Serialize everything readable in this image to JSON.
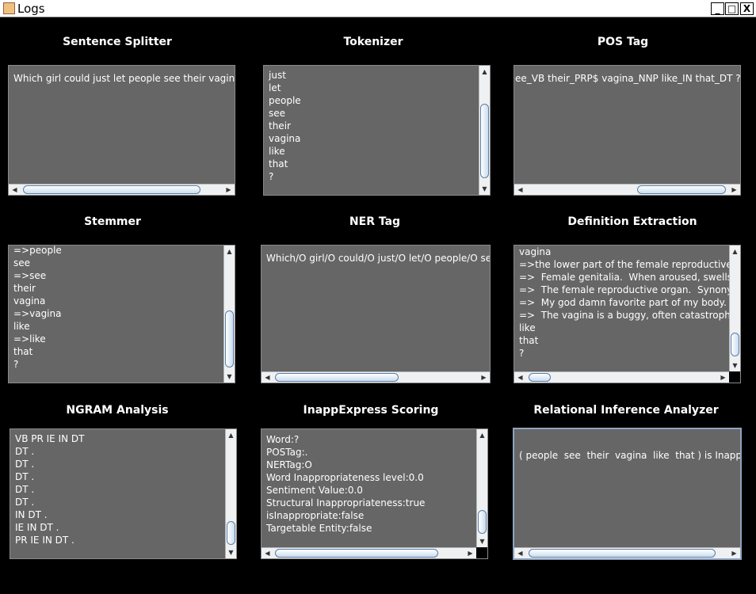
{
  "window": {
    "title": "Logs",
    "minimize": "_",
    "maximize": "□",
    "close": "X"
  },
  "panels": {
    "sentence_splitter": {
      "title": "Sentence Splitter",
      "lines": [
        "Which girl could just let people see their vagina like"
      ]
    },
    "tokenizer": {
      "title": "Tokenizer",
      "lines": [
        "just",
        "let",
        "people",
        "see",
        "their",
        "vagina",
        "like",
        "that",
        "?"
      ]
    },
    "pos_tag": {
      "title": "POS Tag",
      "lines": [
        "ee_VB their_PRP$ vagina_NNP like_IN that_DT ?_."
      ]
    },
    "stemmer": {
      "title": "Stemmer",
      "lines": [
        "=>people",
        "see",
        "=>see",
        "their",
        "vagina",
        "=>vagina",
        "like",
        "=>like",
        "that",
        "?"
      ]
    },
    "ner_tag": {
      "title": "NER Tag",
      "lines": [
        "Which/O girl/O could/O just/O let/O people/O see/O t"
      ]
    },
    "definition_extraction": {
      "title": "Definition Extraction",
      "lines": [
        "vagina",
        "=>the lower part of the female reproductive tract;",
        "=>  Female genitalia.  When aroused, swells and",
        "=>  The female reproductive organ.  Synonyms ir",
        "=>  My god damn favorite part of my body. Whene",
        "=>  The vagina is a buggy, often catastrophically",
        "like",
        "that",
        "?"
      ]
    },
    "ngram_analysis": {
      "title": "NGRAM Analysis",
      "lines": [
        "VB PR IE IN DT",
        "DT .",
        "DT .",
        "DT .",
        "DT .",
        "DT .",
        "IN DT .",
        "IE IN DT .",
        "PR IE IN DT ."
      ]
    },
    "inappexpress_scoring": {
      "title": "InappExpress Scoring",
      "lines": [
        "Word:?",
        "POSTag:.",
        "NERTag:O",
        "Word Inappropriateness level:0.0",
        "Sentiment Value:0.0",
        "Structural Inappropriateness:true",
        "isInappropriate:false",
        "Targetable Entity:false"
      ]
    },
    "relational_inference": {
      "title": "Relational Inference Analyzer",
      "lines": [
        "( people  see  their  vagina  like  that ) is Inappropria"
      ]
    }
  },
  "icons": {
    "scroll_left": "◀",
    "scroll_right": "▶",
    "scroll_up": "▲",
    "scroll_down": "▼"
  }
}
